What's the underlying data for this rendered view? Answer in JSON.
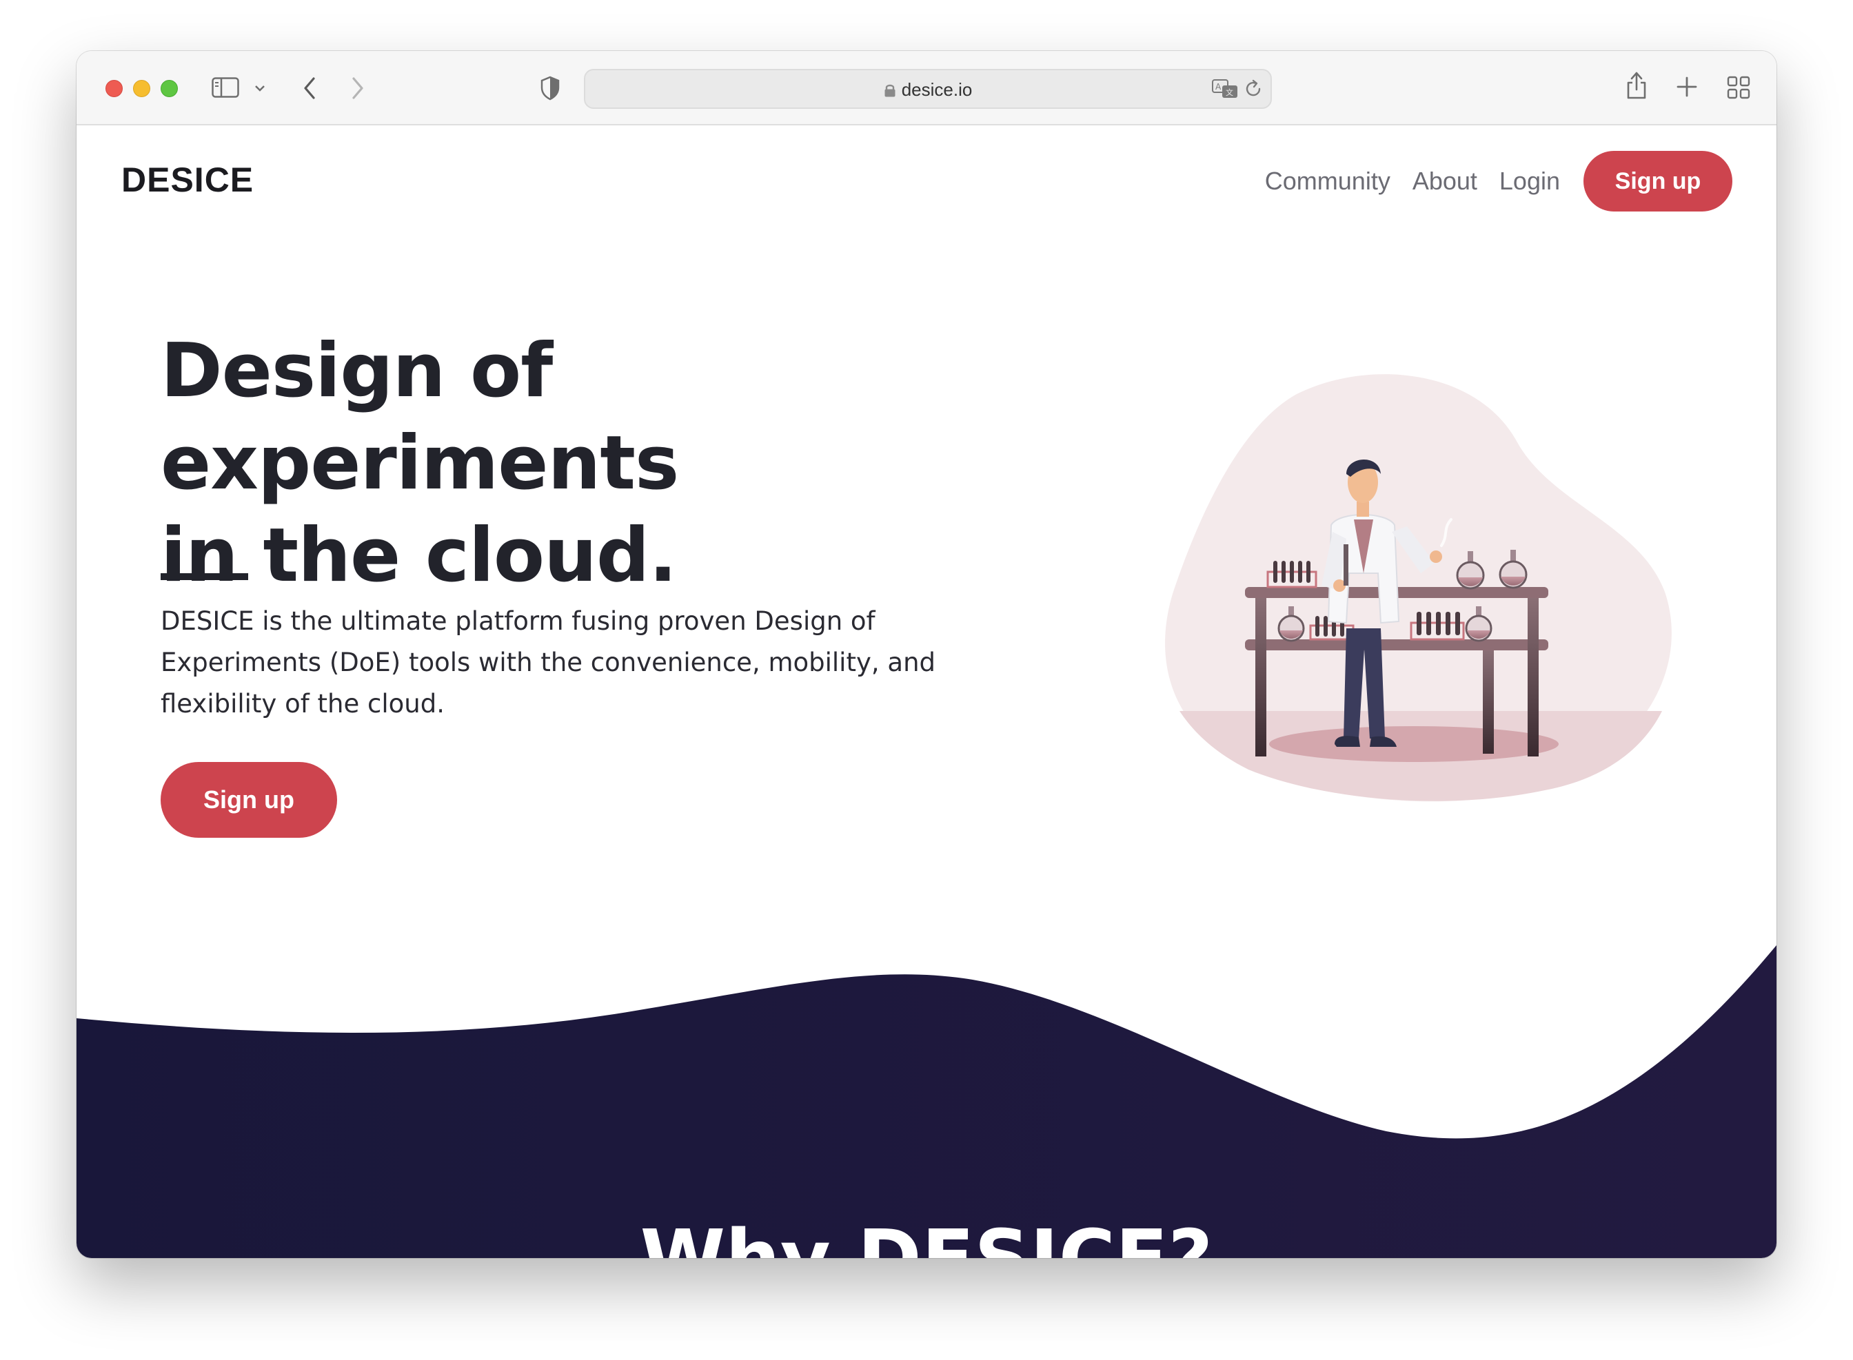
{
  "browser": {
    "url": "desice.io"
  },
  "header": {
    "brand": "DESICE",
    "nav": [
      {
        "label": "Community"
      },
      {
        "label": "About"
      },
      {
        "label": "Login"
      }
    ],
    "signup_label": "Sign up"
  },
  "hero": {
    "title_line1": "Design of experiments",
    "title_line2": "in the cloud.",
    "description": "DESICE is the ultimate platform fusing proven Design of Experiments (DoE) tools with the convenience, mobility, and flexibility of the cloud.",
    "signup_label": "Sign up"
  },
  "why": {
    "title": "Why DESICE?"
  },
  "colors": {
    "accent": "#cd444e",
    "dark_section": "#1c1a3b",
    "text": "#22232b",
    "blob": "#f3e9ea"
  },
  "icons": [
    "sidebar-icon",
    "chevron-down-icon",
    "back-icon",
    "forward-icon",
    "shield-icon",
    "lock-icon",
    "translate-icon",
    "reload-icon",
    "share-icon",
    "new-tab-icon",
    "tab-overview-icon"
  ]
}
